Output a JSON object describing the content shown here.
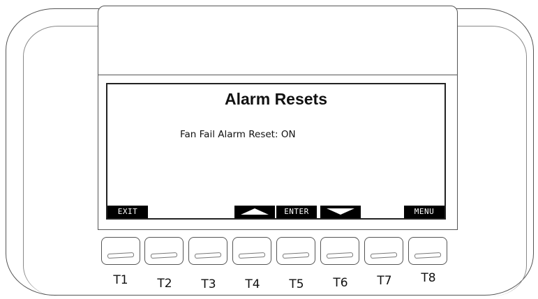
{
  "screen": {
    "title": "Alarm Resets",
    "line_label": "Fan Fail Alarm Reset:",
    "line_value": "ON"
  },
  "softkeys": {
    "exit": "EXIT",
    "up": "up-arrow",
    "enter": "ENTER",
    "down": "down-arrow",
    "menu": "MENU"
  },
  "keys": [
    "T1",
    "T2",
    "T3",
    "T4",
    "T5",
    "T6",
    "T7",
    "T8"
  ]
}
